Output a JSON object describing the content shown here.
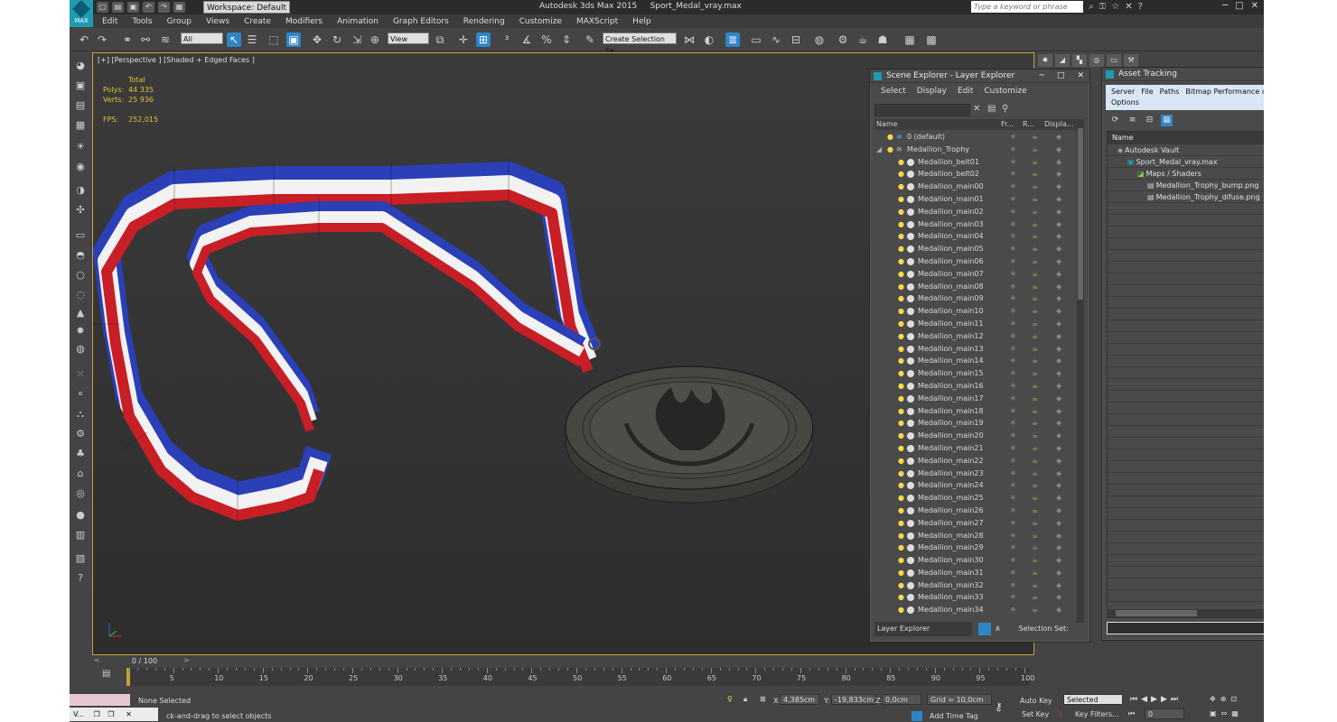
{
  "titlebar": {
    "app_title": "Autodesk 3ds Max  2015",
    "file_title": "Sport_Medal_vray.max",
    "workspace": "Workspace: Default",
    "search_placeholder": "Type a keyword or phrase",
    "logo": "MAX"
  },
  "menu": [
    "Edit",
    "Tools",
    "Group",
    "Views",
    "Create",
    "Modifiers",
    "Animation",
    "Graph Editors",
    "Rendering",
    "Customize",
    "MAXScript",
    "Help"
  ],
  "toolbar": {
    "filter": "All",
    "refcoord": "View",
    "selection_set": "Create Selection Se"
  },
  "viewport": {
    "label": "[+] [Perspective ] [Shaded + Edged Faces ]",
    "stats_header": "Total",
    "polys_label": "Polys:",
    "polys_value": "44 335",
    "verts_label": "Verts:",
    "verts_value": "25 936",
    "fps_label": "FPS:",
    "fps_value": "252,015"
  },
  "scene_explorer": {
    "title": "Scene Explorer - Layer Explorer",
    "menu": [
      "Select",
      "Display",
      "Edit",
      "Customize"
    ],
    "columns": [
      "Name",
      "Fr...",
      "R...",
      "Displa..."
    ],
    "layer_default": "0 (default)",
    "layer_trophy": "Medallion_Trophy",
    "objects": [
      "Medallion_belt01",
      "Medallion_belt02",
      "Medallion_main00",
      "Medallion_main01",
      "Medallion_main02",
      "Medallion_main03",
      "Medallion_main04",
      "Medallion_main05",
      "Medallion_main06",
      "Medallion_main07",
      "Medallion_main08",
      "Medallion_main09",
      "Medallion_main10",
      "Medallion_main11",
      "Medallion_main12",
      "Medallion_main13",
      "Medallion_main14",
      "Medallion_main15",
      "Medallion_main16",
      "Medallion_main17",
      "Medallion_main18",
      "Medallion_main19",
      "Medallion_main20",
      "Medallion_main21",
      "Medallion_main22",
      "Medallion_main23",
      "Medallion_main24",
      "Medallion_main25",
      "Medallion_main26",
      "Medallion_main27",
      "Medallion_main28",
      "Medallion_main29",
      "Medallion_main30",
      "Medallion_main31",
      "Medallion_main32",
      "Medallion_main33",
      "Medallion_main34"
    ],
    "footer_mode": "Layer Explorer",
    "footer_selset": "Selection Set:"
  },
  "asset_tracking": {
    "title": "Asset Tracking",
    "menu": [
      "Server",
      "File",
      "Paths",
      "Bitmap Performance and Memory",
      "Options"
    ],
    "column": "Name",
    "rows": [
      {
        "indent": 1,
        "label": "Autodesk Vault"
      },
      {
        "indent": 2,
        "label": "Sport_Medal_vray.max"
      },
      {
        "indent": 3,
        "label": "Maps / Shaders"
      },
      {
        "indent": 4,
        "label": "Medallion_Trophy_bump.png"
      },
      {
        "indent": 4,
        "label": "Medallion_Trophy_difuse.png"
      }
    ]
  },
  "timeline": {
    "position": "0 / 100",
    "ticks": [
      "5",
      "10",
      "15",
      "20",
      "25",
      "30",
      "35",
      "40",
      "45",
      "50",
      "55",
      "60",
      "65",
      "70",
      "75",
      "80",
      "85",
      "90",
      "95",
      "100"
    ]
  },
  "status": {
    "selection": "None Selected",
    "prompt": "ck-and-drag to select objects",
    "x_label": "X:",
    "x_value": "4,385cm",
    "y_label": "Y:",
    "y_value": "-19,833cm",
    "z_label": "Z:",
    "z_value": "0,0cm",
    "grid": "Grid = 10,0cm",
    "add_time_tag": "Add Time Tag",
    "auto_key": "Auto Key",
    "set_key": "Set Key",
    "key_mode": "Selected",
    "key_filters": "Key Filters...",
    "frame": "0",
    "task_label": "V..."
  },
  "colors": {
    "accent": "#2f86c7",
    "viewport_border": "#c9a13a",
    "stats_text": "#e2c030",
    "ribbon_blue": "#2a3fb8",
    "ribbon_red": "#c81e26"
  }
}
